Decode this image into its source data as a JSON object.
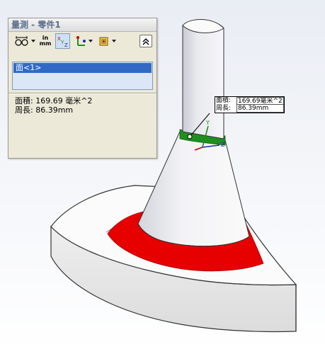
{
  "window": {
    "title": "量測 - 零件1"
  },
  "toolbar": {
    "buttons": [
      {
        "name": "arc-circle-options-icon"
      },
      {
        "name": "units-precision-icon",
        "label_top": "in",
        "label_bottom": "mm"
      },
      {
        "name": "show-xyz-measurements-icon"
      },
      {
        "name": "point-to-point-icon"
      },
      {
        "name": "coordinate-system-icon"
      },
      {
        "name": "collapse-icon"
      }
    ]
  },
  "selection": {
    "items": [
      "面<1>"
    ]
  },
  "results": {
    "area": "面積: 169.69 毫米^2",
    "perimeter": "周長: 86.39mm"
  },
  "callout": {
    "area_label": "面積:",
    "area_value": "169.69毫米^2",
    "perimeter_label": "周長:",
    "perimeter_value": "86.39mm"
  },
  "colors": {
    "selected_face": "#e60000",
    "highlight_band": "#1f8f1f",
    "selection_bg": "#316ac5"
  }
}
